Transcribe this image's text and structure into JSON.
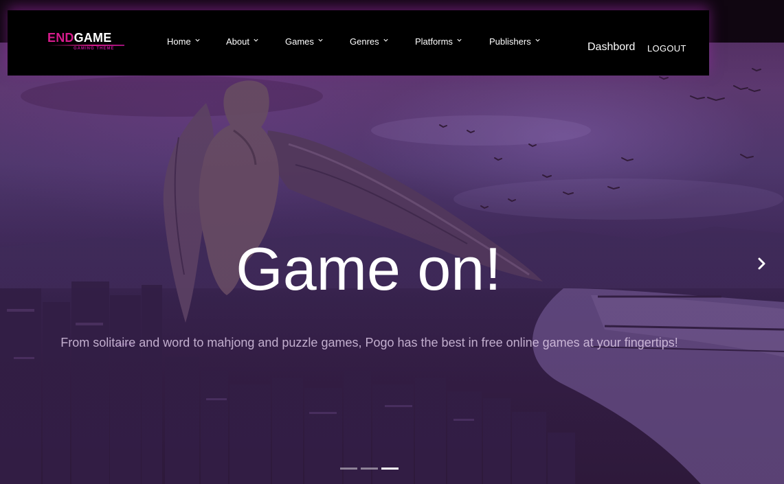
{
  "brand": {
    "name_part1": "END",
    "name_part2": "GAME",
    "tagline": "GAMING THEME",
    "accent_color": "#d81b8c"
  },
  "nav": {
    "items": [
      {
        "label": "Home",
        "icon": "chevron-down-icon"
      },
      {
        "label": "About",
        "icon": "chevron-down-icon"
      },
      {
        "label": "Games",
        "icon": "chevron-down-icon"
      },
      {
        "label": "Genres",
        "icon": "chevron-down-icon"
      },
      {
        "label": "Platforms",
        "icon": "chevron-down-icon"
      },
      {
        "label": "Publishers",
        "icon": "chevron-down-icon"
      }
    ],
    "dashboard_label": "Dashbord",
    "logout_label": "LOGOUT"
  },
  "hero": {
    "heading": "Game on!",
    "text": "From solitaire and word to mahjong and puzzle games, Pogo has the best in free online games at your fingertips!",
    "next_icon": "chevron-right-icon",
    "slide_count": 3,
    "active_slide": 3
  }
}
